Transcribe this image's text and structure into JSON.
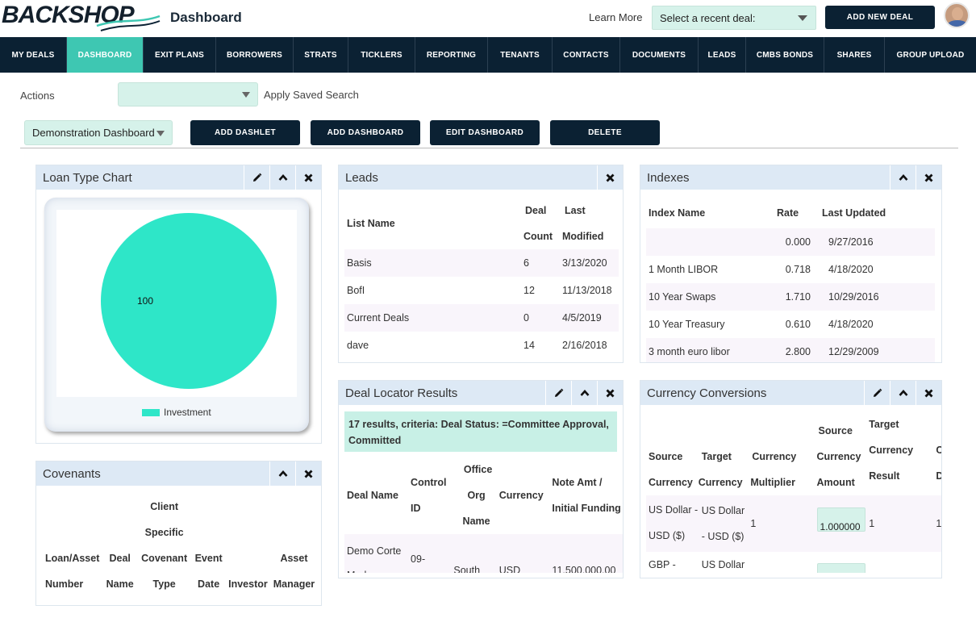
{
  "header": {
    "logo_text": "BACKSHOP",
    "page_title": "Dashboard",
    "learn_more": "Learn More",
    "recent_deal_placeholder": "Select a recent deal:",
    "add_new_deal": "ADD NEW DEAL"
  },
  "nav": {
    "items": [
      "MY DEALS",
      "DASHBOARD",
      "EXIT PLANS",
      "BORROWERS",
      "STRATS",
      "TICKLERS",
      "REPORTING",
      "TENANTS",
      "CONTACTS",
      "DOCUMENTS",
      "LEADS",
      "CMBS BONDS",
      "SHARES",
      "GROUP UPLOAD"
    ],
    "active": "DASHBOARD"
  },
  "actions": {
    "label": "Actions",
    "apply_saved_search": "Apply Saved Search",
    "dashboard_select": "Demonstration Dashboard",
    "buttons": [
      "ADD DASHLET",
      "ADD DASHBOARD",
      "EDIT DASHBOARD",
      "DELETE"
    ]
  },
  "loan_type_chart": {
    "title": "Loan Type Chart",
    "chart_data": {
      "type": "pie",
      "categories": [
        "Investment"
      ],
      "values": [
        100
      ],
      "data_labels": [
        "100"
      ],
      "legend": "bottom",
      "colors": [
        "#2ee6c8"
      ]
    }
  },
  "covenants": {
    "title": "Covenants",
    "columns": [
      [
        "Loan/Asset",
        "Number"
      ],
      [
        "Deal",
        "Name"
      ],
      [
        "Client",
        "Specific",
        "Covenant",
        "Type"
      ],
      [
        "Event",
        "Date"
      ],
      [
        "Investor"
      ],
      [
        "Asset",
        "Manager"
      ]
    ]
  },
  "leads": {
    "title": "Leads",
    "columns": [
      [
        "List Name"
      ],
      [
        "Deal",
        "Count"
      ],
      [
        "Last",
        "Modified"
      ]
    ],
    "rows": [
      [
        "Basis",
        "6",
        "3/13/2020"
      ],
      [
        "BofI",
        "12",
        "11/13/2018"
      ],
      [
        "Current Deals",
        "0",
        "4/5/2019"
      ],
      [
        "dave",
        "14",
        "2/16/2018"
      ]
    ]
  },
  "deal_locator": {
    "title": "Deal Locator Results",
    "summary": "17 results, criteria: Deal Status: =Committee Approval, Committed",
    "columns": [
      [
        "Deal Name"
      ],
      [
        "Control",
        "ID"
      ],
      [
        "Office",
        "Org",
        "Name"
      ],
      [
        "Currency"
      ],
      [
        "Note Amt /",
        "Initial Funding"
      ]
    ],
    "rows": [
      [
        "Demo Corte Madera",
        "09-",
        "South",
        "USD",
        "11,500,000.00"
      ]
    ]
  },
  "indexes": {
    "title": "Indexes",
    "columns": [
      "Index Name",
      "Rate",
      "Last Updated"
    ],
    "rows": [
      [
        "",
        "0.000",
        "9/27/2016"
      ],
      [
        "1 Month LIBOR",
        "0.718",
        "4/18/2020"
      ],
      [
        "10 Year Swaps",
        "1.710",
        "10/29/2016"
      ],
      [
        "10 Year Treasury",
        "0.610",
        "4/18/2020"
      ],
      [
        "3 month euro libor",
        "2.800",
        "12/29/2009"
      ]
    ]
  },
  "currency_conversions": {
    "title": "Currency Conversions",
    "columns": [
      [
        "Source",
        "Currency"
      ],
      [
        "Target",
        "Currency"
      ],
      [
        "Currency",
        "Multiplier"
      ],
      [
        "Source",
        "Currency",
        "Amount"
      ],
      [
        "Target",
        "Currency",
        "Result"
      ],
      [
        "C",
        "D"
      ]
    ],
    "rows": [
      [
        "US Dollar - USD ($)",
        "US Dollar - USD ($)",
        "1",
        "1.000000",
        "1",
        "1"
      ],
      [
        "GBP -",
        "US Dollar",
        "",
        "",
        "",
        ""
      ]
    ]
  },
  "colors": {
    "navy": "#0b2133",
    "teal_active": "#3ec7b2",
    "mint": "#d6f2ea",
    "panel_header": "#dde9f5",
    "pie": "#2ee6c8"
  }
}
